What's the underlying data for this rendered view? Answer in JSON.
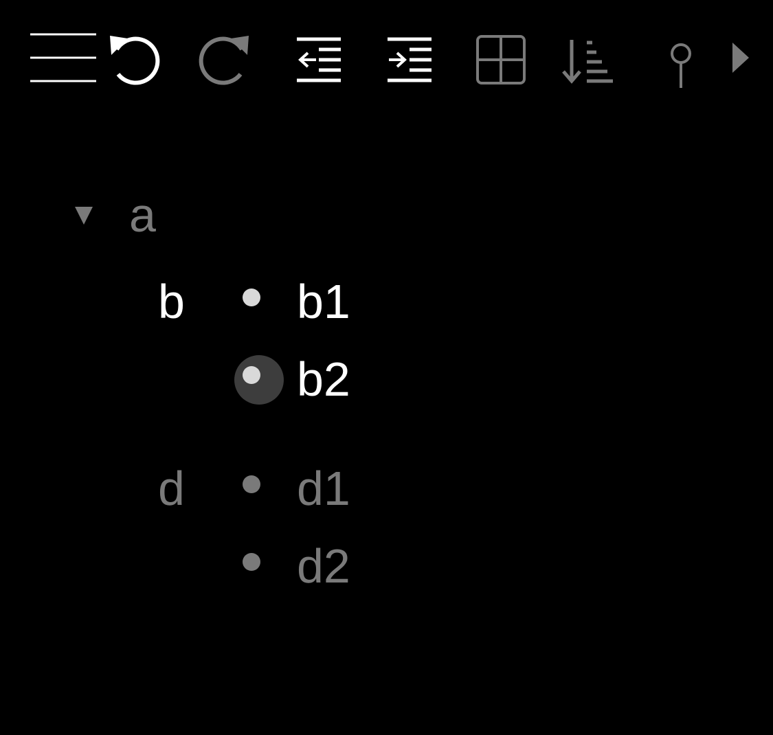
{
  "toolbar": {
    "items": [
      {
        "icon": "hamburger-menu-icon",
        "label": "menu",
        "enabled": true
      },
      {
        "icon": "undo-icon",
        "label": "undo",
        "enabled": true
      },
      {
        "icon": "redo-icon",
        "label": "redo",
        "enabled": false
      },
      {
        "icon": "outdent-icon",
        "label": "outdent",
        "enabled": true
      },
      {
        "icon": "indent-icon",
        "label": "indent",
        "enabled": true
      },
      {
        "icon": "grid-icon",
        "label": "grid",
        "enabled": false
      },
      {
        "icon": "sort-icon",
        "label": "sort",
        "enabled": false
      },
      {
        "icon": "pin-icon",
        "label": "pin",
        "enabled": false
      },
      {
        "icon": "caret-right-icon",
        "label": "more",
        "enabled": false
      }
    ]
  },
  "colors": {
    "background": "#000000",
    "active_text": "#ffffff",
    "inactive_text": "#7a7a7a",
    "active_bullet": "#d9d9d9",
    "inactive_bullet": "#7a7a7a",
    "selected_ring": "#3d3d3d"
  },
  "outline": {
    "root": {
      "label": "a",
      "expanded": true,
      "children": [
        {
          "label": "b",
          "active": true,
          "children": [
            {
              "label": "b1",
              "selected": false
            },
            {
              "label": "b2",
              "selected": true
            }
          ]
        },
        {
          "label": "d",
          "active": false,
          "children": [
            {
              "label": "d1",
              "selected": false
            },
            {
              "label": "d2",
              "selected": false
            }
          ]
        }
      ]
    }
  }
}
